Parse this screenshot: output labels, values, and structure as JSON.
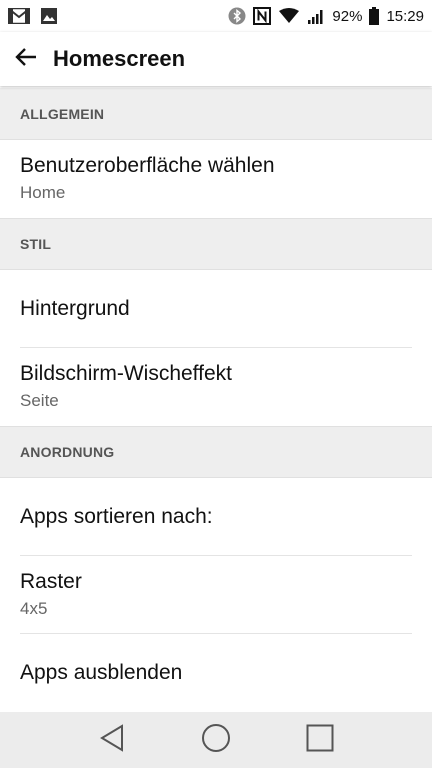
{
  "status_bar": {
    "battery": "92%",
    "time": "15:29",
    "icons": [
      "gmail-icon",
      "image-icon",
      "bluetooth-icon",
      "nfc-icon",
      "wifi-icon",
      "signal-icon",
      "battery-icon"
    ]
  },
  "app_bar": {
    "title": "Homescreen",
    "back_icon": "arrow-back-icon"
  },
  "sections": {
    "allgemein": {
      "header": "ALLGEMEIN",
      "ui_select": {
        "title": "Benutzeroberfläche wählen",
        "subtitle": "Home"
      }
    },
    "stil": {
      "header": "STIL",
      "wallpaper": {
        "title": "Hintergrund"
      },
      "swipe_effect": {
        "title": "Bildschirm-Wischeffekt",
        "subtitle": "Seite"
      }
    },
    "anordnung": {
      "header": "ANORDNUNG",
      "sort_apps": {
        "title": "Apps sortieren nach:"
      },
      "grid": {
        "title": "Raster",
        "subtitle": "4x5"
      },
      "hide_apps": {
        "title": "Apps ausblenden"
      }
    }
  },
  "nav_bar": {
    "buttons": [
      "back-triangle-icon",
      "home-circle-icon",
      "recents-square-icon"
    ]
  },
  "colors": {
    "background": "#ffffff",
    "section_header_bg": "#eeeeee",
    "section_header_text": "#555555",
    "nav_bar_bg": "#ececec"
  }
}
